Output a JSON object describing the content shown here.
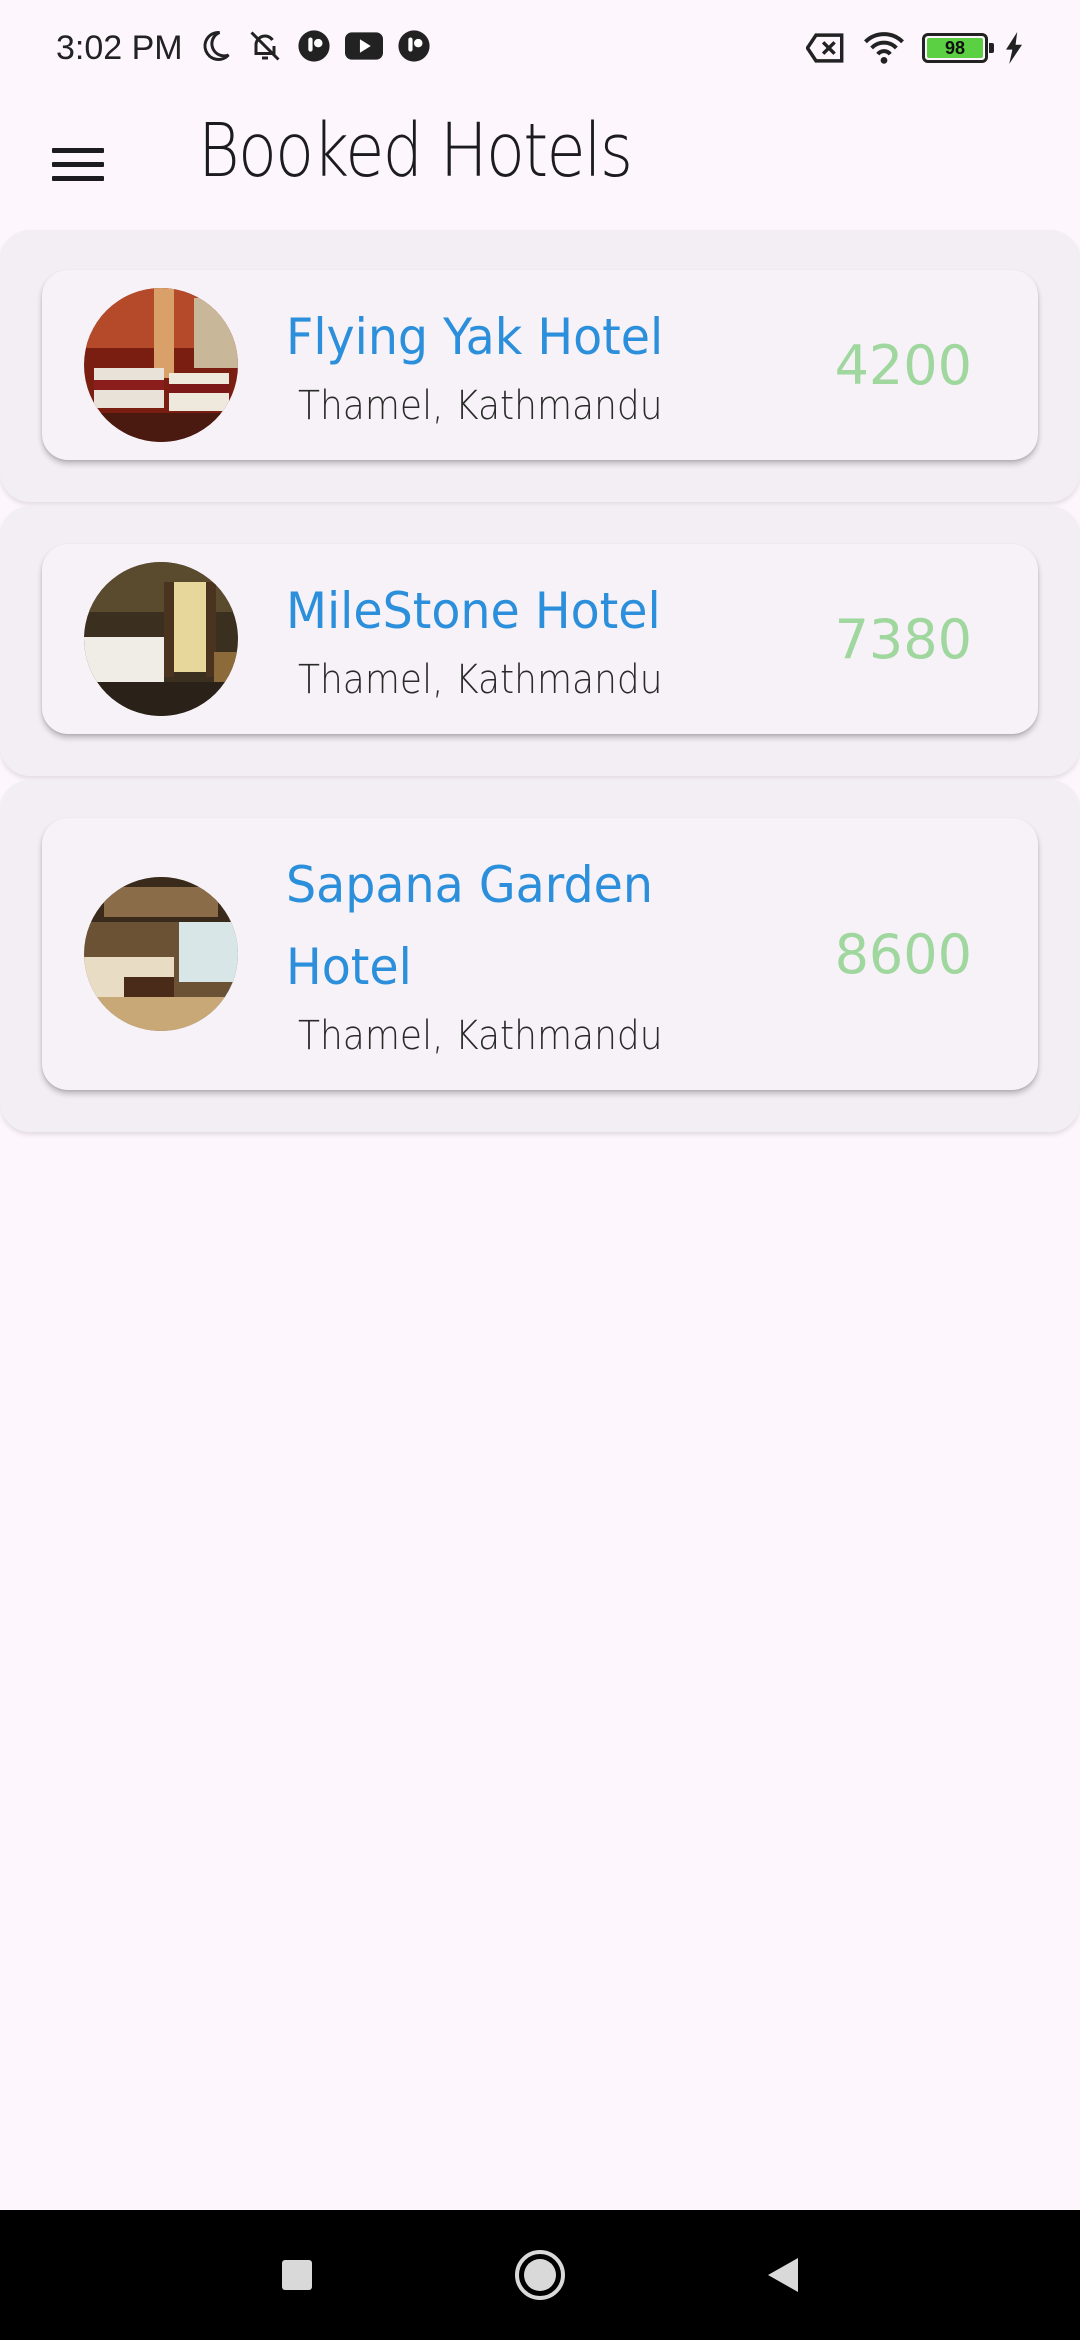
{
  "status_bar": {
    "time": "3:02 PM",
    "battery_level": "98",
    "icons": [
      "moon-icon",
      "bell-off-icon",
      "app-icon",
      "youtube-icon",
      "app-icon",
      "sim-off-icon",
      "wifi-icon",
      "battery-icon",
      "charging-icon"
    ]
  },
  "app_bar": {
    "title": "Booked Hotels",
    "menu_icon": "menu-icon"
  },
  "hotels": [
    {
      "name": "Flying Yak Hotel",
      "location": "Thamel, Kathmandu",
      "price": "4200"
    },
    {
      "name": "MileStone Hotel",
      "location": "Thamel, Kathmandu",
      "price": "7380"
    },
    {
      "name": "Sapana Garden Hotel",
      "location": "Thamel, Kathmandu",
      "price": "8600"
    }
  ],
  "colors": {
    "hotel_name": "#2b8fdb",
    "price": "#9fd79f",
    "background": "#fdf7fd",
    "card": "#f6f2f7"
  },
  "nav_bar": {
    "buttons": [
      "recents-square-icon",
      "home-circle-icon",
      "back-triangle-icon"
    ]
  }
}
